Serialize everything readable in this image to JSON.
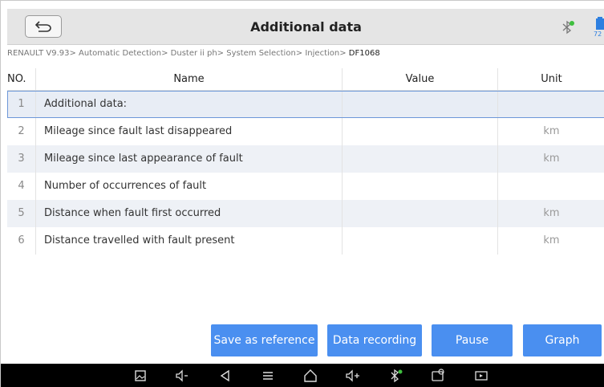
{
  "header": {
    "title": "Additional data",
    "battery_label": "72"
  },
  "breadcrumb": {
    "path": "RENAULT V9.93> Automatic Detection> Duster ii ph> System Selection> Injection>",
    "current": " DF1068"
  },
  "table": {
    "columns": {
      "no": "NO.",
      "name": "Name",
      "value": "Value",
      "unit": "Unit"
    },
    "rows": [
      {
        "no": "1",
        "name": "Additional data:",
        "value": "",
        "unit": ""
      },
      {
        "no": "2",
        "name": "Mileage since fault last disappeared",
        "value": "",
        "unit": "km"
      },
      {
        "no": "3",
        "name": "Mileage since last appearance of fault",
        "value": "",
        "unit": "km"
      },
      {
        "no": "4",
        "name": "Number of occurrences of fault",
        "value": "",
        "unit": ""
      },
      {
        "no": "5",
        "name": "Distance when fault first occurred",
        "value": "",
        "unit": "km"
      },
      {
        "no": "6",
        "name": "Distance travelled with fault present",
        "value": "",
        "unit": "km"
      }
    ]
  },
  "actions": {
    "save_reference": "Save as reference",
    "data_recording": "Data recording",
    "pause": "Pause",
    "graph": "Graph"
  },
  "navbar": {
    "icons": [
      "gallery-icon",
      "volume-down-icon",
      "back-icon",
      "menu-icon",
      "home-icon",
      "volume-up-icon",
      "bluetooth-icon",
      "vci-icon",
      "screen-record-icon"
    ]
  },
  "colors": {
    "accent": "#4a8ff0",
    "header_bg": "#e5e5e5",
    "row_alt": "#eef1f6",
    "selected_border": "#6c97d8",
    "navbar_bg": "#000000"
  }
}
